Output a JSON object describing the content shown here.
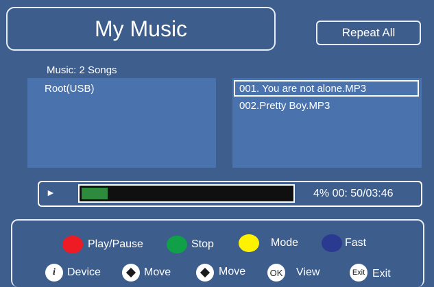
{
  "header": {
    "title": "My Music",
    "repeat_label": "Repeat All"
  },
  "library": {
    "count_label": "Music:  2 Songs",
    "folders": [
      "Root(USB)"
    ],
    "songs": [
      "001. You are not alone.MP3",
      "002.Pretty Boy.MP3"
    ],
    "selected_song_index": 0
  },
  "player": {
    "play_glyph": "►",
    "progress_fraction": 0.04,
    "status_text": "4% 00: 50/03:46"
  },
  "legend": {
    "color_keys": [
      {
        "label": "Play/Pause",
        "color": "#ee1b24"
      },
      {
        "label": "Stop",
        "color": "#0fa048"
      },
      {
        "label": "Mode",
        "color": "#fff200"
      },
      {
        "label": "Fast",
        "color": "#2a3a90"
      }
    ],
    "nav_keys": [
      {
        "icon": "info-icon",
        "glyph": "i",
        "label": "Device"
      },
      {
        "icon": "up-down-arrow-icon",
        "glyph": "",
        "label": "Move"
      },
      {
        "icon": "left-right-arrow-icon",
        "glyph": "",
        "label": "Move"
      },
      {
        "icon": "ok-icon",
        "glyph": "OK",
        "label": "View"
      },
      {
        "icon": "exit-icon",
        "glyph": "Exit",
        "label": "Exit"
      }
    ]
  }
}
